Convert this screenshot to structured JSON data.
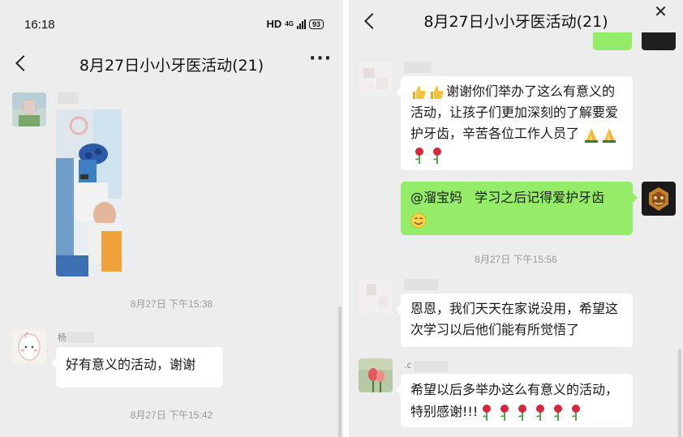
{
  "status_bar": {
    "time": "16:18",
    "network": "HD",
    "network_sub": "4G",
    "battery": "93"
  },
  "chat": {
    "title": "8月27日小小牙医活动(21)"
  },
  "left_panel": {
    "timestamps": [
      "8月27日 下午15:38",
      "8月27日 下午15:42"
    ],
    "messages": [
      {
        "sender_name": ""
      },
      {
        "sender_name": "杨",
        "text": "好有意义的活动，谢谢"
      }
    ]
  },
  "right_panel": {
    "timestamps": [
      "8月27日 下午15:56"
    ],
    "messages": [
      {
        "text": "谢谢你们举办了这么有意义的活动，让孩子们更加深刻的了解要爱护牙齿，辛苦各位工作人员了"
      },
      {
        "mention": "@溜宝妈",
        "text": "学习之后记得爱护牙齿"
      },
      {
        "text": "恩恩，我们天天在家说没用，希望这次学习以后他们能有所觉悟了"
      },
      {
        "sender_name": ".c",
        "text": "希望以后多举办这么有意义的活动，特别感谢!!!"
      }
    ]
  },
  "emoji": {
    "thumbs": "thumbs-up-icon",
    "pray": "pray-icon",
    "rose": "rose-icon",
    "smile": "smile-icon"
  },
  "colors": {
    "background": "#ededed",
    "bubble_self": "#95ec69",
    "bubble_other": "#ffffff",
    "timestamp": "#999999"
  }
}
